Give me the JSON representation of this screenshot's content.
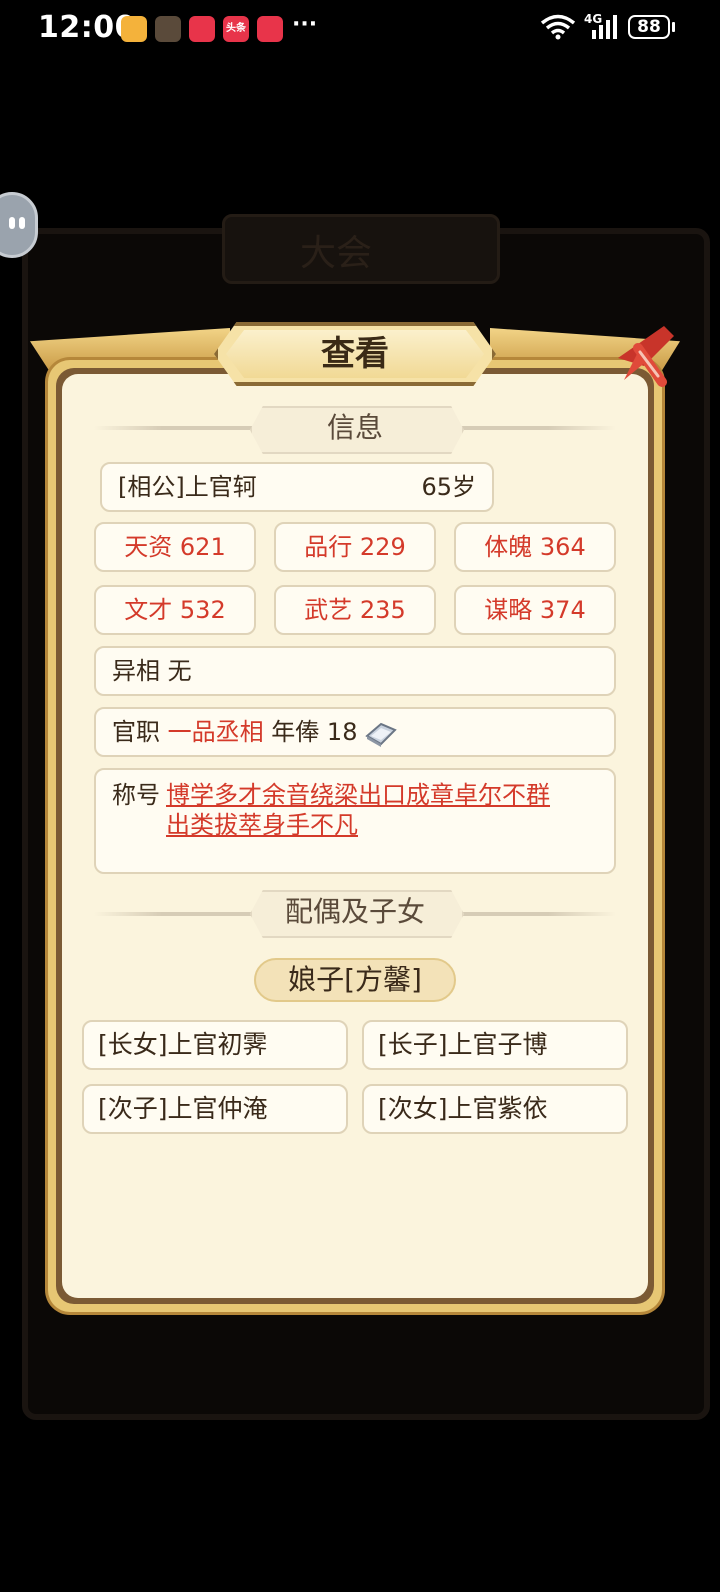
{
  "status_bar": {
    "time": "12:00",
    "more": "···",
    "network": "4G",
    "battery": "88",
    "notif_4_label": "头条"
  },
  "background": {
    "title_partial": "大会"
  },
  "panel": {
    "title": "查看",
    "section_info": "信息",
    "section_family": "配偶及子女"
  },
  "person": {
    "name": "[相公]上官轲",
    "age": "65岁"
  },
  "stats": [
    "天资 621",
    "品行 229",
    "体魄 364",
    "文才 532",
    "武艺 235",
    "谋略 374"
  ],
  "traits": {
    "label": "异相",
    "value": "无"
  },
  "office": {
    "label": "官职",
    "rank": "一品丞相",
    "salary_label": "年俸",
    "salary_value": "18"
  },
  "titles": {
    "label": "称号",
    "line1": "博学多才余音绕梁出口成章卓尔不群",
    "line2": "出类拔萃身手不凡"
  },
  "spouse": {
    "label": "娘子[方馨]"
  },
  "children": [
    "[长女]上官初霁",
    "[长子]上官子博",
    "[次子]上官仲淹",
    "[次女]上官紫依"
  ],
  "colors": {
    "accent_red": "#d43a2a",
    "panel_cream": "#fbf4dd",
    "gold": "#e7c774"
  }
}
